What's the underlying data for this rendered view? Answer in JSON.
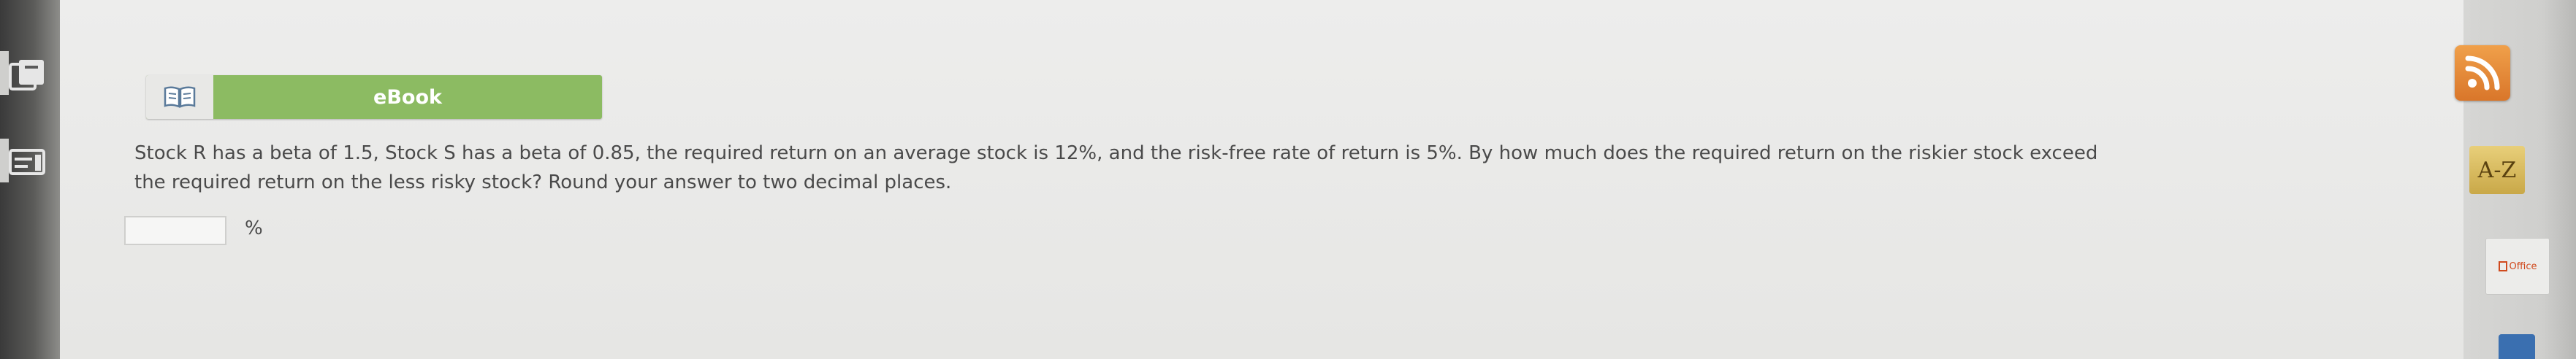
{
  "ebook": {
    "label": "eBook",
    "icon": "book-icon"
  },
  "question": {
    "line1": "Stock R has a beta of 1.5, Stock S has a beta of 0.85, the required return on an average stock is 12%, and the risk-free rate of return is 5%. By how much does the required return on the riskier stock exceed",
    "line2": "the required return on the less risky stock? Round your answer to two decimal places."
  },
  "answer": {
    "value": "",
    "unit": "%"
  },
  "right_rail": {
    "rss_icon": "rss-icon",
    "az_label": "A-Z",
    "office_label": "Office"
  },
  "left_rail": {
    "icons": [
      "notebook-icon",
      "panel-icon"
    ]
  },
  "colors": {
    "ebook_green": "#8cbb62",
    "rss_orange": "#e48a3a",
    "az_gold": "#d8bc60",
    "question_text": "#4a4a4a"
  }
}
